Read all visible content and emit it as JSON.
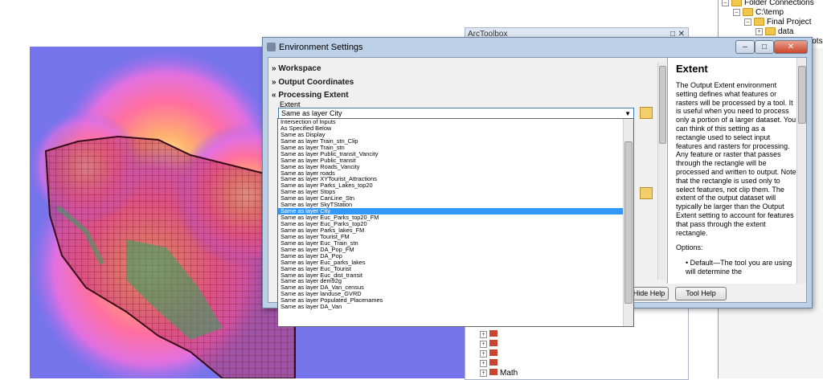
{
  "catalog": {
    "items": [
      "Folder Connections",
      "C:\\temp",
      "Final Project",
      "data",
      "Screenshots"
    ]
  },
  "toolbox": {
    "title": "ArcToolbox",
    "last_item": "Math"
  },
  "env": {
    "title": "Environment Settings",
    "sections": [
      "Workspace",
      "Output Coordinates",
      "Processing Extent"
    ],
    "extent_label": "Extent",
    "extent_value": "Same as layer City",
    "options": [
      "Intersection of Inputs",
      "As Specified Below",
      "Same as Display",
      "Same as layer Train_stn_Clip",
      "Same as layer Train_stn",
      "Same as layer Public_transit_Vancity",
      "Same as layer Public_transit",
      "Same as layer Roads_Vancity",
      "Same as layer roads",
      "Same as layer XYTourist_Attractions",
      "Same as layer Parks_Lakes_top20",
      "Same as layer Stops",
      "Same as layer CanLine_Stn",
      "Same as layer SkyTStation",
      "Same as layer City",
      "Same as layer Euc_Parks_top20_FM",
      "Same as layer Euc_Parks_top20",
      "Same as layer Parks_lakes_FM",
      "Same as layer Tourist_FM",
      "Same as layer Euc_Train_stn",
      "Same as layer DA_Pop_FM",
      "Same as layer DA_Pop",
      "Same as layer Euc_parks_lakes",
      "Same as layer Euc_Tourist",
      "Same as layer Euc_dist_transit",
      "Same as layer dem92g",
      "Same as layer DA_Van_census",
      "Same as layer landuse_GVRD",
      "Same as layer Populated_Placenames",
      "Same as layer DA_Van"
    ],
    "selected_index": 14,
    "buttons": {
      "hide_help": "<< Hide Help",
      "tool_help": "Tool Help"
    },
    "window_buttons": {
      "minimize": "–",
      "maximize": "□",
      "close": "✕"
    }
  },
  "help": {
    "title": "Extent",
    "body": "The Output Extent environment setting defines what features or rasters will be processed by a tool. It is useful when you need to process only a portion of a larger dataset. You can think of this setting as a rectangle used to select input features and rasters for processing. Any feature or raster that passes through the rectangle will be processed and written to output. Note that the rectangle is used only to select features, not clip them. The extent of the output dataset will typically be larger than the Output Extent setting to account for features that pass through the extent rectangle.",
    "options_label": "Options:",
    "bullet": "Default—The tool you are using will determine the"
  },
  "colors": {
    "selection": "#3399ff",
    "titlebar": "#bcd0e8",
    "map_bg": "#6b78e8"
  }
}
